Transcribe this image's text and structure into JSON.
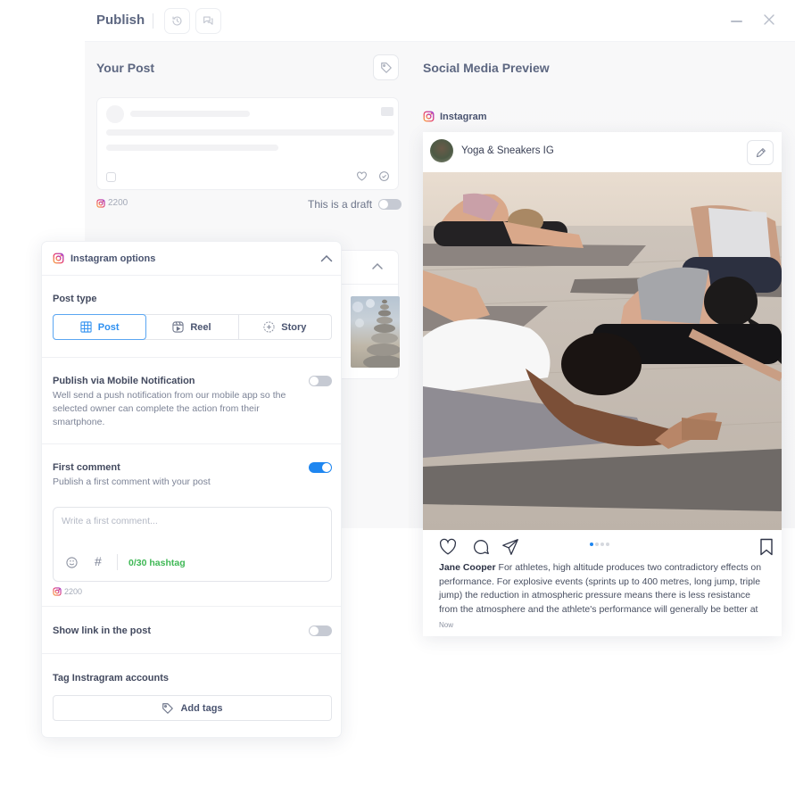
{
  "header": {
    "title": "Publish",
    "icons": [
      "history-icon",
      "comments-icon"
    ],
    "window_controls": [
      "minimize-icon",
      "close-icon"
    ]
  },
  "your_post": {
    "title": "Your Post",
    "char_counter": "2200",
    "draft_label": "This is a draft",
    "draft_enabled": false
  },
  "preview": {
    "title": "Social Media Preview",
    "network": "Instagram",
    "account_name": "Yoga & Sneakers IG",
    "caption_author": "Jane Cooper",
    "caption_text": "For athletes, high altitude produces two contradictory effects on performance. For explosive events (sprints up to 400 metres, long jump, triple jump) the reduction in atmospheric pressure means there is less resistance from the atmosphere and the athlete's performance will generally be better at",
    "timestamp": "Now",
    "carousel": {
      "total": 4,
      "active_index": 0
    },
    "accent_color": "#1e86f0"
  },
  "options": {
    "title": "Instagram options",
    "post_type": {
      "label": "Post type",
      "options": [
        {
          "label": "Post",
          "icon": "grid-icon",
          "selected": true
        },
        {
          "label": "Reel",
          "icon": "reel-icon",
          "selected": false
        },
        {
          "label": "Story",
          "icon": "story-icon",
          "selected": false
        }
      ]
    },
    "mobile_notification": {
      "label": "Publish via Mobile Notification",
      "description": "Well send a push notification from our mobile app so the selected owner can complete the action from their smartphone.",
      "enabled": false
    },
    "first_comment": {
      "label": "First comment",
      "description": "Publish a first comment with your post",
      "enabled": true,
      "placeholder": "Write a first comment...",
      "value": "",
      "hashtag_count": "0/30 hashtag",
      "char_counter": "2200"
    },
    "show_link": {
      "label": "Show link in the post",
      "enabled": false
    },
    "tag_accounts": {
      "label": "Tag Instragram accounts",
      "button_label": "Add tags"
    }
  },
  "colors": {
    "primary": "#1e86f0",
    "success": "#3fb855",
    "text": "#4a5470"
  }
}
